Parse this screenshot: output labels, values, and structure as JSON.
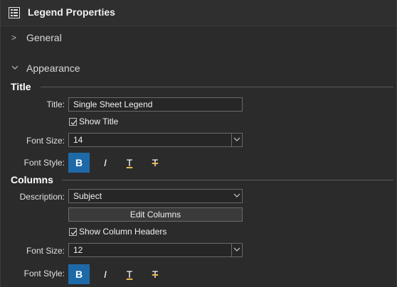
{
  "header": {
    "title": "Legend Properties",
    "icon": "legend-properties-icon"
  },
  "sections": {
    "general": "General",
    "appearance": "Appearance"
  },
  "title_group": {
    "heading": "Title",
    "title_label": "Title:",
    "title_value": "Single Sheet Legend",
    "show_title_label": "Show Title",
    "show_title_checked": true,
    "font_size_label": "Font Size:",
    "font_size_value": "14",
    "font_style_label": "Font Style:",
    "styles": [
      "B",
      "I",
      "T",
      "T"
    ]
  },
  "columns_group": {
    "heading": "Columns",
    "description_label": "Description:",
    "description_value": "Subject",
    "edit_columns_label": "Edit Columns",
    "show_headers_label": "Show Column Headers",
    "show_headers_checked": true,
    "font_size_label": "Font Size:",
    "font_size_value": "12",
    "font_style_label": "Font Style:",
    "styles": [
      "B",
      "I",
      "T",
      "T"
    ]
  },
  "colors": {
    "accent": "#1e6aa8",
    "text_decoration": "#e8b84a"
  }
}
